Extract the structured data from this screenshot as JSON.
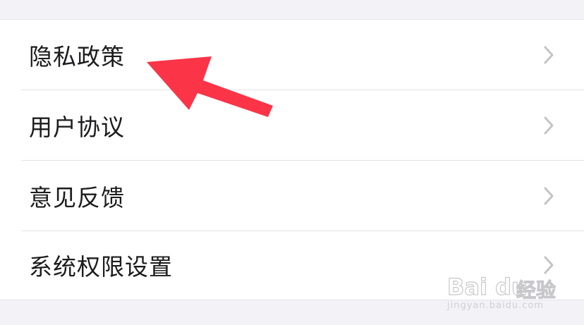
{
  "settings_list": {
    "items": [
      {
        "label": "隐私政策"
      },
      {
        "label": "用户协议"
      },
      {
        "label": "意见反馈"
      },
      {
        "label": "系统权限设置"
      }
    ]
  },
  "annotation": {
    "arrow_color": "#fb3448"
  },
  "watermark": {
    "brand_latin": "Bai du",
    "brand_cn": "经验",
    "url": "jingyan.baidu.com"
  },
  "colors": {
    "background": "#f2f2f7",
    "row_background": "#ffffff",
    "text": "#1c1c1e",
    "chevron": "#c4c4c6",
    "divider": "#e4e4e8"
  }
}
